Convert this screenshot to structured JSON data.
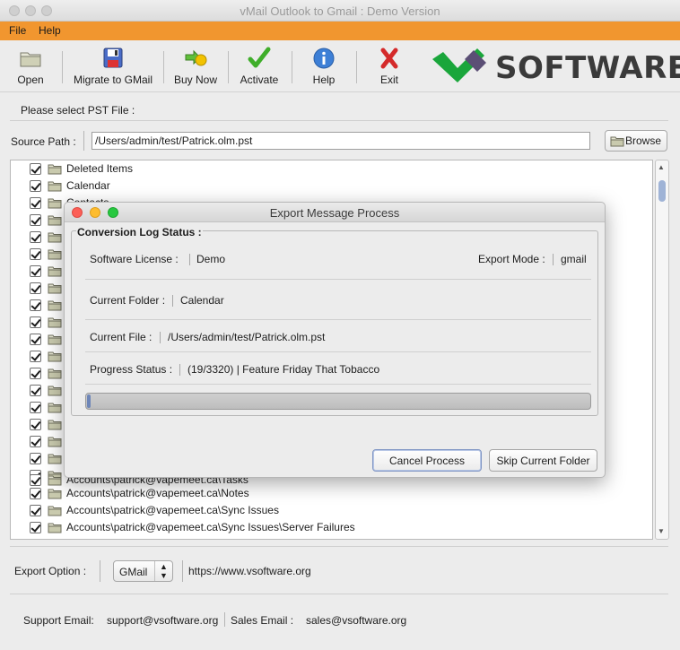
{
  "window": {
    "title": "vMail Outlook to Gmail : Demo Version"
  },
  "menu": [
    "File",
    "Help"
  ],
  "toolbar": {
    "open": "Open",
    "migrate": "Migrate to GMail",
    "buy": "Buy Now",
    "activate": "Activate",
    "help": "Help",
    "exit": "Exit"
  },
  "logo": {
    "text": "SOFTWARE",
    "green": "#1aa63b",
    "purple": "#5b4f75"
  },
  "pst": {
    "select_label": "Please select PST File :",
    "source_label": "Source Path :",
    "source_value": "/Users/admin/test/Patrick.olm.pst",
    "browse_label": "Browse"
  },
  "tree": {
    "items": [
      "Deleted Items",
      "Calendar",
      "Contacts",
      "",
      "",
      "",
      "",
      "",
      "",
      "",
      "",
      "",
      "",
      "",
      "",
      "",
      "",
      "",
      "",
      "Accounts\\patrick@vapemeet.ca\\Tasks",
      "Accounts\\patrick@vapemeet.ca\\Notes",
      "Accounts\\patrick@vapemeet.ca\\Sync Issues",
      "Accounts\\patrick@vapemeet.ca\\Sync Issues\\Server Failures"
    ]
  },
  "dialog": {
    "title": "Export Message Process",
    "group_title": "Conversion Log Status :",
    "license_label": "Software License  :",
    "license_value": "Demo",
    "mode_label": "Export Mode :",
    "mode_value": "gmail",
    "folder_label": "Current Folder :",
    "folder_value": "Calendar",
    "file_label": "Current File :",
    "file_value": "/Users/admin/test/Patrick.olm.pst",
    "progress_label": "Progress Status :",
    "progress_value": "(19/3320) | Feature Friday That Tobacco",
    "progress_fraction": 0.0057,
    "cancel_label": "Cancel Process",
    "skip_label": "Skip Current Folder"
  },
  "export": {
    "label": "Export Option :",
    "selected": "GMail",
    "url": "https://www.vsoftware.org"
  },
  "footer": {
    "support_label": "Support Email:",
    "support_value": "support@vsoftware.org",
    "sales_label": "Sales Email :",
    "sales_value": "sales@vsoftware.org"
  }
}
